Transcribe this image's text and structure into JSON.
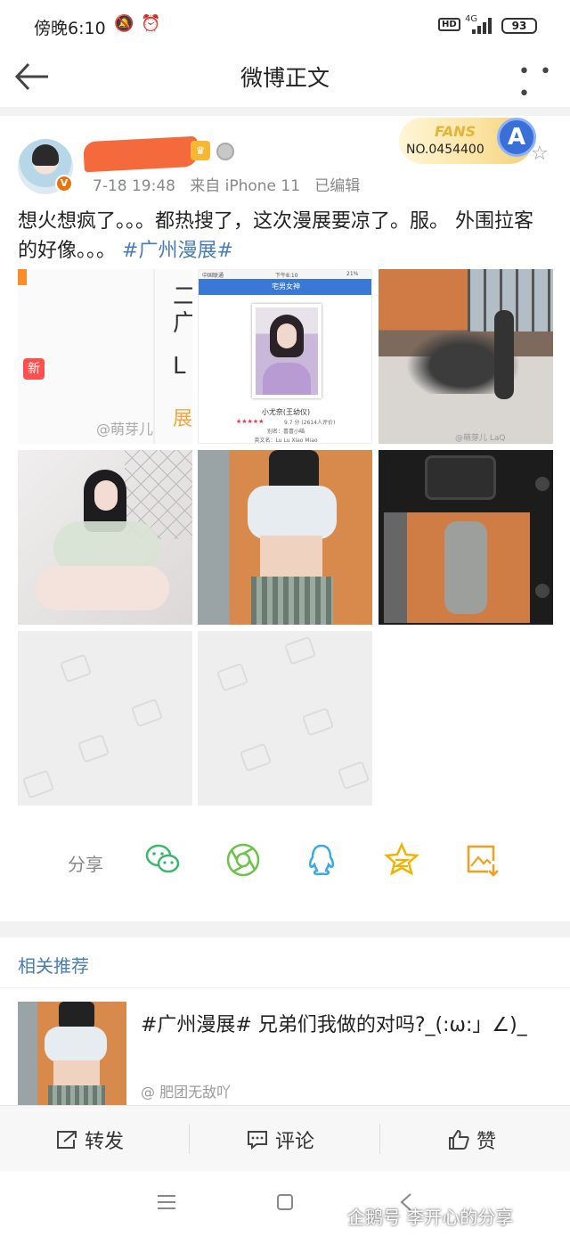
{
  "status_bar": {
    "time": "傍晚6:10",
    "network": "4G",
    "hd": "HD",
    "battery": "93"
  },
  "nav": {
    "title": "微博正文"
  },
  "post": {
    "time": "7-18 19:48",
    "source": "来自 iPhone 11",
    "edited": "已编辑",
    "fans_label": "FANS",
    "fans_number": "NO.0454400",
    "text": "想火想疯了。。。都热搜了，这次漫展要凉了。服。 外围拉客的好像。。。",
    "hashtag": "#广州漫展#",
    "image_texts": {
      "new_badge": "新",
      "watermark": "@萌芽儿",
      "status_carrier": "中国联通",
      "status_time": "下午8:10",
      "status_battery": "21%",
      "app_title": "宅男女神",
      "name_line": "小尤奈(王幼仪)",
      "rating": "9.7 分 (2614人评价)",
      "alias": "别名：喜喜小喵",
      "english_name": "英文名：Lu Lu Xiao Miao",
      "watermark2": "@萌芽儿 LaQ"
    }
  },
  "share": {
    "label": "分享",
    "icons": [
      "wechat-icon",
      "moments-icon",
      "qq-icon",
      "qzone-icon",
      "save-image-icon"
    ]
  },
  "related": {
    "title": "相关推荐",
    "item_text": "#广州漫展# 兄弟们我做的对吗?_(:ω:」∠)_",
    "item_author": "@ 肥团无敌吖"
  },
  "actions": {
    "repost": "转发",
    "comment": "评论",
    "like": "赞"
  },
  "watermark": "企鹅号 李开心的分享"
}
